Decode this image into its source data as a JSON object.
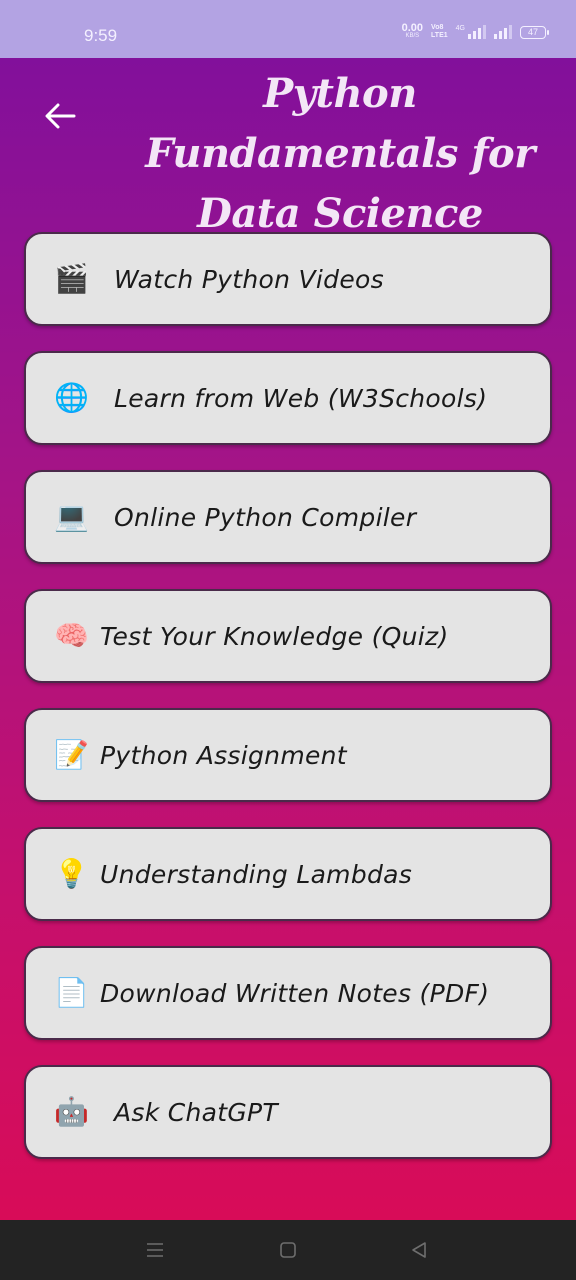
{
  "status_bar": {
    "time": "9:59",
    "net_speed_value": "0.00",
    "net_speed_unit": "KB/S",
    "volte_top": "Vo8",
    "volte_bottom": "LTE1",
    "signal_label": "4G",
    "battery_level": "47"
  },
  "header": {
    "back_icon": "arrow-left-icon",
    "title": "Python Fundamentals for Data Science"
  },
  "menu": {
    "items": [
      {
        "emoji": "🎬",
        "icon": "clapperboard-icon",
        "label": "Watch Python Videos"
      },
      {
        "emoji": "🌐",
        "icon": "globe-icon",
        "label": "Learn from Web (W3Schools)"
      },
      {
        "emoji": "💻",
        "icon": "laptop-icon",
        "label": "Online Python Compiler"
      },
      {
        "emoji": "🧠",
        "icon": "brain-icon",
        "label": "Test Your Knowledge (Quiz)"
      },
      {
        "emoji": "📝",
        "icon": "memo-icon",
        "label": "Python Assignment"
      },
      {
        "emoji": "💡",
        "icon": "lightbulb-icon",
        "label": "Understanding Lambdas"
      },
      {
        "emoji": "📄",
        "icon": "document-icon",
        "label": "Download Written Notes (PDF)"
      },
      {
        "emoji": "🤖",
        "icon": "robot-icon",
        "label": "Ask ChatGPT"
      }
    ]
  },
  "nav_bar": {
    "menu_icon": "recents-menu-icon",
    "home_icon": "home-square-icon",
    "back_icon": "back-triangle-icon"
  },
  "colors": {
    "gradient_top": "#82109b",
    "gradient_bottom": "#d80c58",
    "card_bg": "#e4e4e4",
    "status_bar_bg": "#b3a3e3",
    "nav_bar_bg": "#232323"
  }
}
